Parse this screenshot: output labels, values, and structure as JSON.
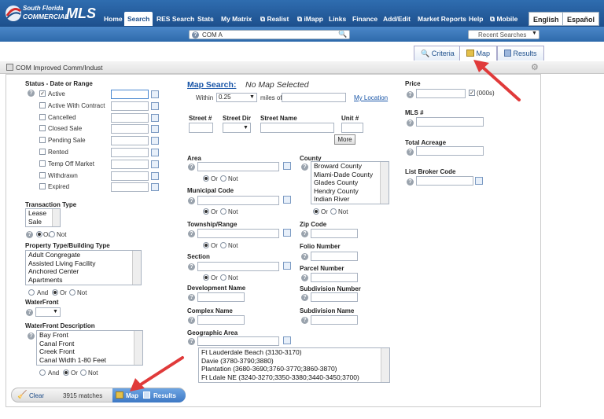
{
  "brand": {
    "line1": "South Florida",
    "line2": "COMMERCIAL",
    "mls": "MLS"
  },
  "nav": {
    "items": [
      "Home",
      "Search",
      "RES Search",
      "Stats",
      "My Matrix",
      "Realist",
      "iMapp",
      "Links",
      "Finance",
      "Add/Edit",
      "Market Reports",
      "Help",
      "Mobile"
    ],
    "selected": "Search",
    "english": "English",
    "espanol": "Español"
  },
  "subnav": {
    "com": "COM A",
    "recent": "Recent Searches"
  },
  "tabs": {
    "criteria": "Criteria",
    "map": "Map",
    "results": "Results"
  },
  "header": {
    "title": "COM Improved Comm/Indust"
  },
  "status": {
    "title": "Status - Date or Range",
    "items": [
      "Active",
      "Active With Contract",
      "Cancelled",
      "Closed Sale",
      "Pending Sale",
      "Rented",
      "Temp Off Market",
      "Withdrawn",
      "Expired"
    ]
  },
  "transaction": {
    "title": "Transaction Type",
    "options": [
      "Lease",
      "Sale"
    ],
    "or": "Or",
    "not": "Not"
  },
  "propertyType": {
    "title": "Property Type/Building Type",
    "options": [
      "Adult Congregate",
      "Assisted Living Facility",
      "Anchored Center",
      "Apartments"
    ],
    "and": "And",
    "or": "Or",
    "not": "Not"
  },
  "waterfront": {
    "title": "WaterFront"
  },
  "waterfrontDesc": {
    "title": "WaterFront Description",
    "options": [
      "Bay Front",
      "Canal Front",
      "Creek Front",
      "Canal Width 1-80 Feet"
    ],
    "and": "And",
    "or": "Or",
    "not": "Not"
  },
  "mapSearch": {
    "title": "Map Search:",
    "status": "No Map Selected",
    "within": "Within",
    "radius": "0.25",
    "milesOf": "miles of",
    "myLocation": "My Location"
  },
  "street": {
    "num": "Street #",
    "dir": "Street Dir",
    "name": "Street Name",
    "unit": "Unit #",
    "more": "More"
  },
  "area": {
    "title": "Area",
    "or": "Or",
    "not": "Not"
  },
  "county": {
    "title": "County",
    "options": [
      "Broward County",
      "Miami-Dade County",
      "Glades County",
      "Hendry County",
      "Indian River"
    ],
    "or": "Or",
    "not": "Not"
  },
  "municipal": {
    "title": "Municipal Code",
    "or": "Or",
    "not": "Not"
  },
  "township": {
    "title": "Township/Range",
    "or": "Or",
    "not": "Not"
  },
  "zip": {
    "title": "Zip Code"
  },
  "section": {
    "title": "Section",
    "or": "Or",
    "not": "Not"
  },
  "folio": {
    "title": "Folio Number"
  },
  "parcel": {
    "title": "Parcel Number"
  },
  "development": {
    "title": "Development Name"
  },
  "subdivisionNum": {
    "title": "Subdivision Number"
  },
  "complex": {
    "title": "Complex Name"
  },
  "subdivisionName": {
    "title": "Subdivision Name"
  },
  "geo": {
    "title": "Geographic Area",
    "options": [
      "Ft Lauderdale Beach (3130-3170)",
      "Davie (3780-3790;3880)",
      "Plantation (3680-3690;3760-3770;3860-3870)",
      "Ft Ldale NE (3240-3270;3350-3380;3440-3450;3700)"
    ]
  },
  "price": {
    "title": "Price",
    "unit": "(000s)"
  },
  "mls": {
    "title": "MLS #"
  },
  "acreage": {
    "title": "Total Acreage"
  },
  "broker": {
    "title": "List Broker Code"
  },
  "bottom": {
    "clear": "Clear",
    "matches": "3915 matches",
    "map": "Map",
    "results": "Results"
  }
}
